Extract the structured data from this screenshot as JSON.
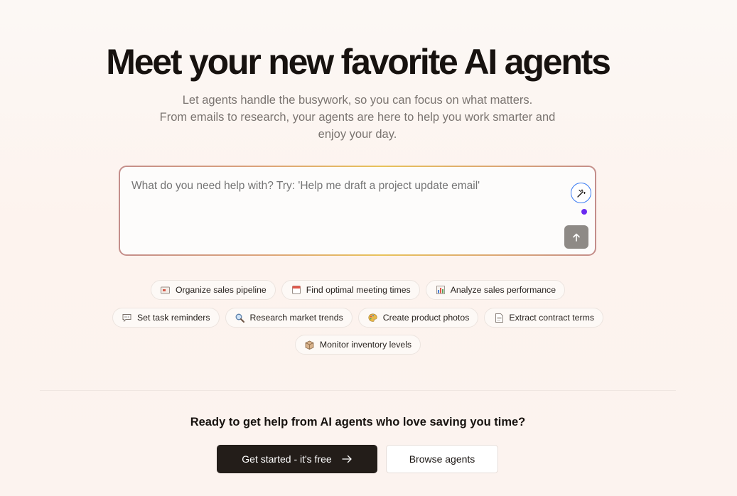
{
  "hero": {
    "title": "Meet your new favorite AI agents",
    "subtitle_lines": [
      "Let agents handle the busywork, so you can focus on what matters.",
      "From emails to research, your agents are here to help you work smarter and",
      "enjoy your day."
    ]
  },
  "prompt": {
    "placeholder": "What do you need help with? Try: 'Help me draft a project update email'"
  },
  "suggestions": {
    "row1": [
      {
        "label": "Organize sales pipeline",
        "icon": "pipeline-icon"
      },
      {
        "label": "Find optimal meeting times",
        "icon": "calendar-icon"
      },
      {
        "label": "Analyze sales performance",
        "icon": "bar-chart-icon"
      }
    ],
    "row2": [
      {
        "label": "Set task reminders",
        "icon": "chat-bubble-icon"
      },
      {
        "label": "Research market trends",
        "icon": "magnifier-icon"
      },
      {
        "label": "Create product photos",
        "icon": "palette-icon"
      },
      {
        "label": "Extract contract terms",
        "icon": "document-icon"
      }
    ],
    "row3": [
      {
        "label": "Monitor inventory levels",
        "icon": "box-icon"
      }
    ]
  },
  "cta": {
    "question": "Ready to get help from AI agents who love saving you time?",
    "primary_label": "Get started - it's free",
    "secondary_label": "Browse agents"
  },
  "colors": {
    "accent_dot": "#6a2bf0",
    "primary_button": "#231d19",
    "magic_button_border": "#3b7bf2"
  }
}
